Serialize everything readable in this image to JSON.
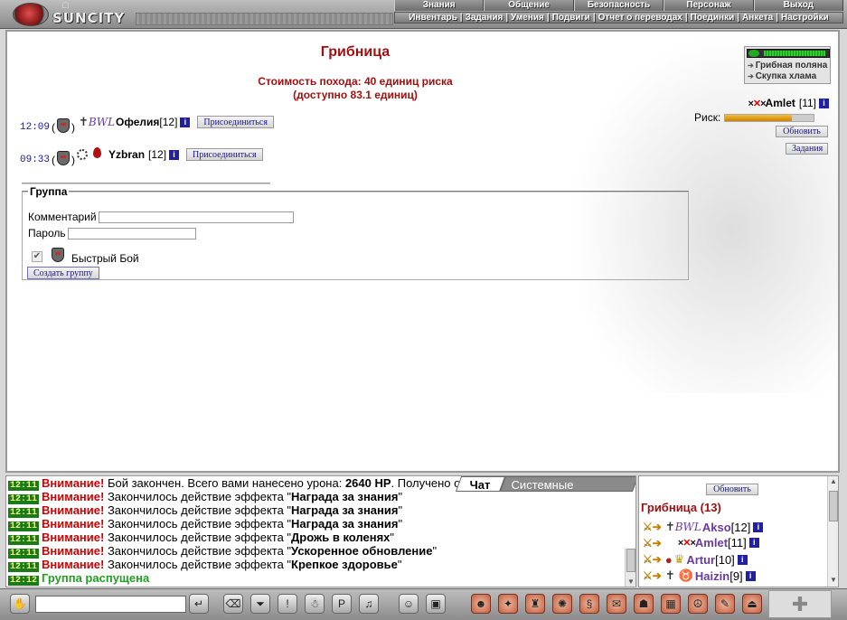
{
  "header": {
    "logo_text": "SUNCITY",
    "menu_top": [
      "Знания",
      "Общение",
      "Безопасность",
      "Персонаж",
      "Выход"
    ],
    "menu_bottom": [
      "Инвентарь",
      "Задания",
      "Умения",
      "Подвиги",
      "Отчет о переводах",
      "Поединки",
      "Анкета",
      "Настройки"
    ]
  },
  "main": {
    "title": "Грибница",
    "cost_line1": "Стоимость похода: 40 единиц риска",
    "cost_line2": "(доступно 83.1 единиц)",
    "requests": [
      {
        "time": "12:09",
        "clan": "BWL",
        "name": "Офелия",
        "level": "[12]",
        "join_label": "Присоединиться"
      },
      {
        "time": "09:33",
        "clan": "",
        "name": "Yzbran",
        "level": "[12]",
        "join_label": "Присоединиться"
      }
    ],
    "group": {
      "legend": "Группа",
      "comment_label": "Комментарий",
      "comment_value": "",
      "password_label": "Пароль",
      "password_value": "",
      "fast_battle_checked": true,
      "fast_battle_label": "Быстрый Бой",
      "create_label": "Создать группу"
    }
  },
  "right_panel": {
    "hp_fraction": 0.95,
    "links": [
      "Грибная поляна",
      "Скупка хлама"
    ],
    "self_name": "Amlet",
    "self_level": "[11]",
    "risk_label": "Риск:",
    "risk_fraction": 0.75,
    "refresh_label": "Обновить",
    "tasks_label": "Задания"
  },
  "chat": {
    "tabs": [
      "Чат",
      "Системные сообщения"
    ],
    "lines": [
      {
        "time": "12:11",
        "warn": "Внимание!",
        "text": " Бой закончен. Всего вами нанесено урона: ",
        "bold": "2640 HP",
        "tail": ". Получено опыта: ..."
      },
      {
        "time": "12:11",
        "warn": "Внимание!",
        "text": " Закончилось действие эффекта \"",
        "bold": "Награда за знания",
        "tail": "\""
      },
      {
        "time": "12:11",
        "warn": "Внимание!",
        "text": " Закончилось действие эффекта \"",
        "bold": "Награда за знания",
        "tail": "\""
      },
      {
        "time": "12:11",
        "warn": "Внимание!",
        "text": " Закончилось действие эффекта \"",
        "bold": "Награда за знания",
        "tail": "\""
      },
      {
        "time": "12:11",
        "warn": "Внимание!",
        "text": " Закончилось действие эффекта \"",
        "bold": "Дрожь в коленях",
        "tail": "\""
      },
      {
        "time": "12:11",
        "warn": "Внимание!",
        "text": " Закончилось действие эффекта \"",
        "bold": "Ускоренное обновление",
        "tail": "\""
      },
      {
        "time": "12:11",
        "warn": "Внимание!",
        "text": " Закончилось действие эффекта \"",
        "bold": "Крепкое здоровье",
        "tail": "\""
      },
      {
        "time": "12:12",
        "green": "Группа распущена"
      }
    ]
  },
  "users": {
    "refresh_label": "Обновить",
    "heading": "Грибница (13)",
    "list": [
      {
        "name": "Akso",
        "level": "[12]"
      },
      {
        "name": "Amlet",
        "level": "[11]"
      },
      {
        "name": "Artur",
        "level": "[10]"
      },
      {
        "name": "Haizin",
        "level": "[9]"
      }
    ]
  },
  "toolbar": {
    "chat_input_value": ""
  }
}
